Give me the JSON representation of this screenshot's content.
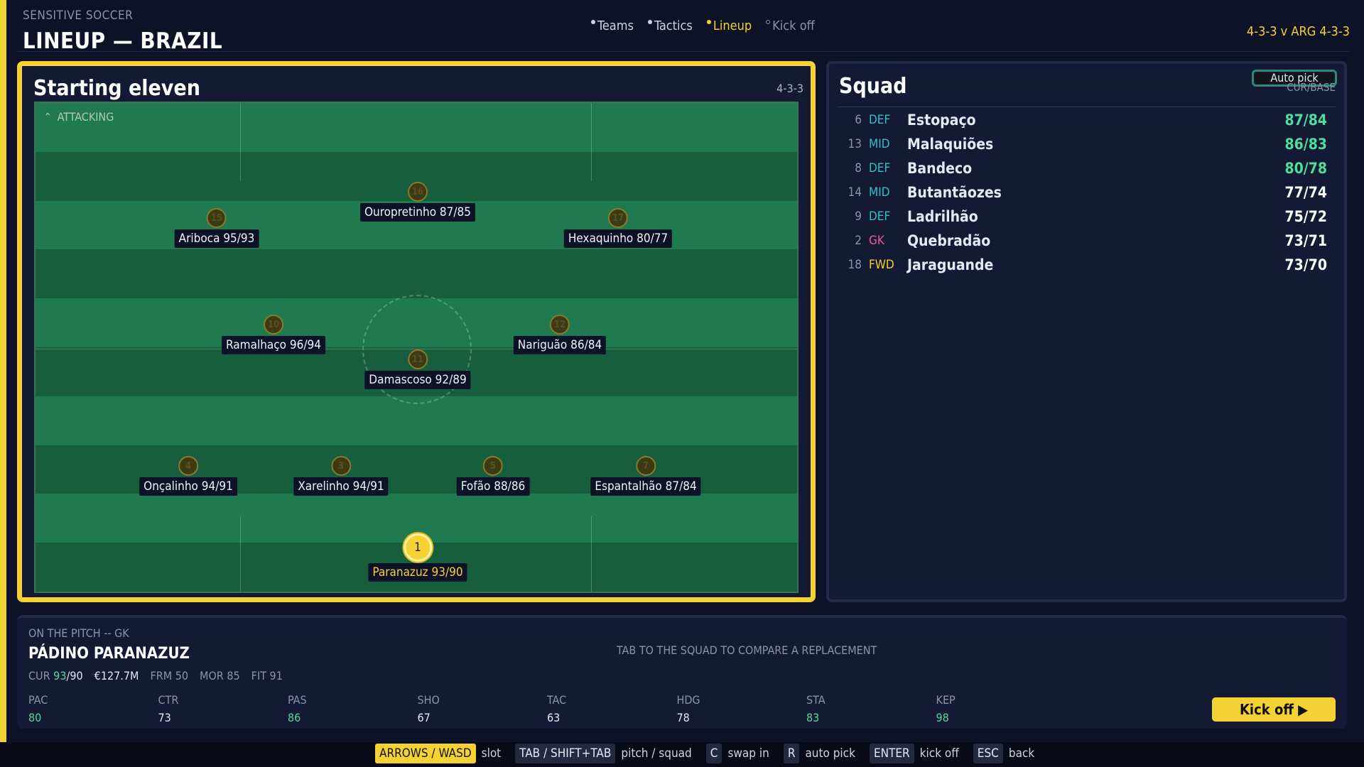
{
  "header": {
    "brand": "SENSITIVE SOCCER",
    "title": "LINEUP — BRAZIL",
    "steps": [
      {
        "label": "Teams",
        "state": "done"
      },
      {
        "label": "Tactics",
        "state": "done"
      },
      {
        "label": "Lineup",
        "state": "active"
      },
      {
        "label": "Kick off",
        "state": "pending"
      }
    ],
    "matchup": "4-3-3 v ARG 4-3-3"
  },
  "starting_eleven": {
    "title": "Starting eleven",
    "formation": "4-3-3",
    "attacking_label": "ATTACKING",
    "players": [
      {
        "number": "15",
        "label": "Ariboca 95/93"
      },
      {
        "number": "16",
        "label": "Ouropretinho 87/85"
      },
      {
        "number": "17",
        "label": "Hexaquinho 80/77"
      },
      {
        "number": "10",
        "label": "Ramalhaço 96/94"
      },
      {
        "number": "11",
        "label": "Damascoso 92/89"
      },
      {
        "number": "12",
        "label": "Nariguão 86/84"
      },
      {
        "number": "4",
        "label": "Onçalinho 94/91"
      },
      {
        "number": "3",
        "label": "Xarelinho 94/91"
      },
      {
        "number": "5",
        "label": "Fofão 88/86"
      },
      {
        "number": "7",
        "label": "Espantalhão 87/84"
      },
      {
        "number": "1",
        "label": "Paranazuz 93/90",
        "selected": true
      }
    ]
  },
  "squad": {
    "title": "Squad",
    "auto_pick_label": "Auto pick",
    "column_label": "CUR/BASE",
    "rows": [
      {
        "number": "6",
        "position": "DEF",
        "name": "Estopaço",
        "rating": "87/84",
        "highlight": true
      },
      {
        "number": "13",
        "position": "MID",
        "name": "Malaquiões",
        "rating": "86/83",
        "highlight": true
      },
      {
        "number": "8",
        "position": "DEF",
        "name": "Bandeco",
        "rating": "80/78",
        "highlight": true
      },
      {
        "number": "14",
        "position": "MID",
        "name": "Butantãozes",
        "rating": "77/74",
        "highlight": false
      },
      {
        "number": "9",
        "position": "DEF",
        "name": "Ladrilhão",
        "rating": "75/72",
        "highlight": false
      },
      {
        "number": "2",
        "position": "GK",
        "name": "Quebradão",
        "rating": "73/71",
        "highlight": false
      },
      {
        "number": "18",
        "position": "FWD",
        "name": "Jaraguande",
        "rating": "73/70",
        "highlight": false
      }
    ],
    "position_colors": {
      "DEF": "#2fc1c9",
      "MID": "#2fc1c9",
      "GK": "#e85a9a",
      "FWD": "#f5d233"
    }
  },
  "selected_player": {
    "context": "ON THE PITCH -- GK",
    "name": "PÁDINO PARANAZUZ",
    "cur_label": "CUR",
    "cur": "93",
    "base": "/90",
    "value": "€127.7M",
    "form": "FRM 50",
    "morale": "MOR 85",
    "fitness": "FIT 91",
    "hint": "TAB TO THE SQUAD TO COMPARE A REPLACEMENT",
    "attributes": [
      {
        "name": "PAC",
        "value": "80",
        "good": true
      },
      {
        "name": "CTR",
        "value": "73",
        "good": false
      },
      {
        "name": "PAS",
        "value": "86",
        "good": true
      },
      {
        "name": "SHO",
        "value": "67",
        "good": false
      },
      {
        "name": "TAC",
        "value": "63",
        "good": false
      },
      {
        "name": "HDG",
        "value": "78",
        "good": false
      },
      {
        "name": "STA",
        "value": "83",
        "good": true
      },
      {
        "name": "KEP",
        "value": "98",
        "good": true
      }
    ],
    "kick_off_label": "Kick off ▶"
  },
  "footer": {
    "hints": [
      {
        "key": "ARROWS / WASD",
        "desc": "slot",
        "primary": true
      },
      {
        "key": "TAB / SHIFT+TAB",
        "desc": "pitch / squad",
        "primary": false
      },
      {
        "key": "C",
        "desc": "swap in",
        "primary": false
      },
      {
        "key": "R",
        "desc": "auto pick",
        "primary": false
      },
      {
        "key": "ENTER",
        "desc": "kick off",
        "primary": false
      },
      {
        "key": "ESC",
        "desc": "back",
        "primary": false
      }
    ]
  },
  "colors": {
    "accent": "#f5d233",
    "good": "#4fdc9c",
    "panel": "#141a33",
    "background": "#0d1226"
  }
}
